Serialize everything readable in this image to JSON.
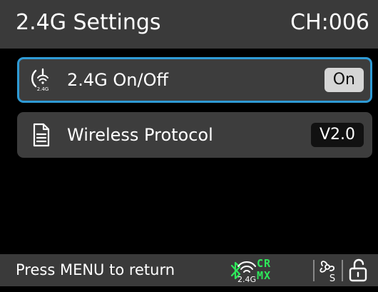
{
  "header": {
    "title": "2.4G Settings",
    "channel": "CH:006"
  },
  "menu": {
    "items": [
      {
        "icon": "wireless-2.4g-icon",
        "label": "2.4G On/Off",
        "value": "On",
        "selected": true
      },
      {
        "icon": "document-icon",
        "label": "Wireless Protocol",
        "value": "V2.0",
        "selected": false
      }
    ]
  },
  "footer": {
    "hint": "Press MENU to return",
    "status_icons": [
      "bluetooth-icon",
      "wireless-2.4g-icon",
      "crmx-icon",
      "fan-icon",
      "unlock-icon"
    ],
    "crmx_line1": "CR",
    "crmx_line2": "MX",
    "icon_2g4_label": "2.4G",
    "fan_label": "S"
  },
  "colors": {
    "accent": "#2f9bd6",
    "status_green": "#2ee85a",
    "header_bg": "#3a3a3a",
    "row_bg": "#3d3d3d",
    "background": "#000000"
  }
}
